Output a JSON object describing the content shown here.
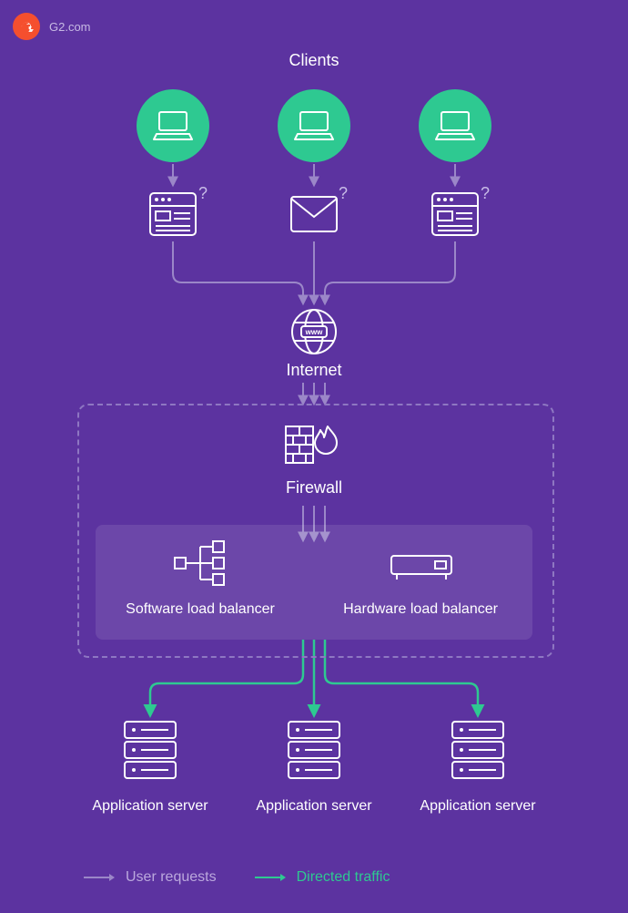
{
  "header": {
    "site": "G2.com"
  },
  "labels": {
    "clients": "Clients",
    "internet": "Internet",
    "firewall": "Firewall",
    "software_lb": "Software load balancer",
    "hardware_lb": "Hardware load balancer",
    "app_server_1": "Application server",
    "app_server_2": "Application server",
    "app_server_3": "Application server"
  },
  "legend": {
    "user_requests": "User requests",
    "directed_traffic": "Directed traffic"
  },
  "colors": {
    "bg": "#5C33A0",
    "accent_green": "#2EC991",
    "line_muted": "#9B87C8",
    "line_white": "#FFFFFF"
  },
  "icons": {
    "globe_text": "www"
  },
  "question_marks": {
    "q1": "?",
    "q2": "?",
    "q3": "?"
  }
}
